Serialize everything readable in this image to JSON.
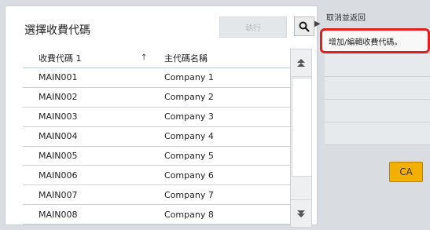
{
  "panel": {
    "title": "選擇收費代碼",
    "execute_label": "執行"
  },
  "table": {
    "columns": [
      "收費代碼 1",
      "主代碼名稱"
    ],
    "sort_indicator": "↑",
    "rows": [
      {
        "code": "MAIN001",
        "name": "Company 1"
      },
      {
        "code": "MAIN002",
        "name": "Company 2"
      },
      {
        "code": "MAIN003",
        "name": "Company 3"
      },
      {
        "code": "MAIN004",
        "name": "Company 4"
      },
      {
        "code": "MAIN005",
        "name": "Company 5"
      },
      {
        "code": "MAIN006",
        "name": "Company 6"
      },
      {
        "code": "MAIN007",
        "name": "Company 7"
      },
      {
        "code": "MAIN008",
        "name": "Company 8"
      }
    ]
  },
  "scrollbar": {
    "up_icon": "double-chevron-up",
    "down_icon": "double-chevron-down"
  },
  "side_menu": {
    "top_item": "取消並返回",
    "active_item": "增加/編輯收費代碼。"
  },
  "ca_button": {
    "label": "CA"
  },
  "colors": {
    "highlight_border": "#e0201f",
    "ca_button": "#f3b000"
  }
}
